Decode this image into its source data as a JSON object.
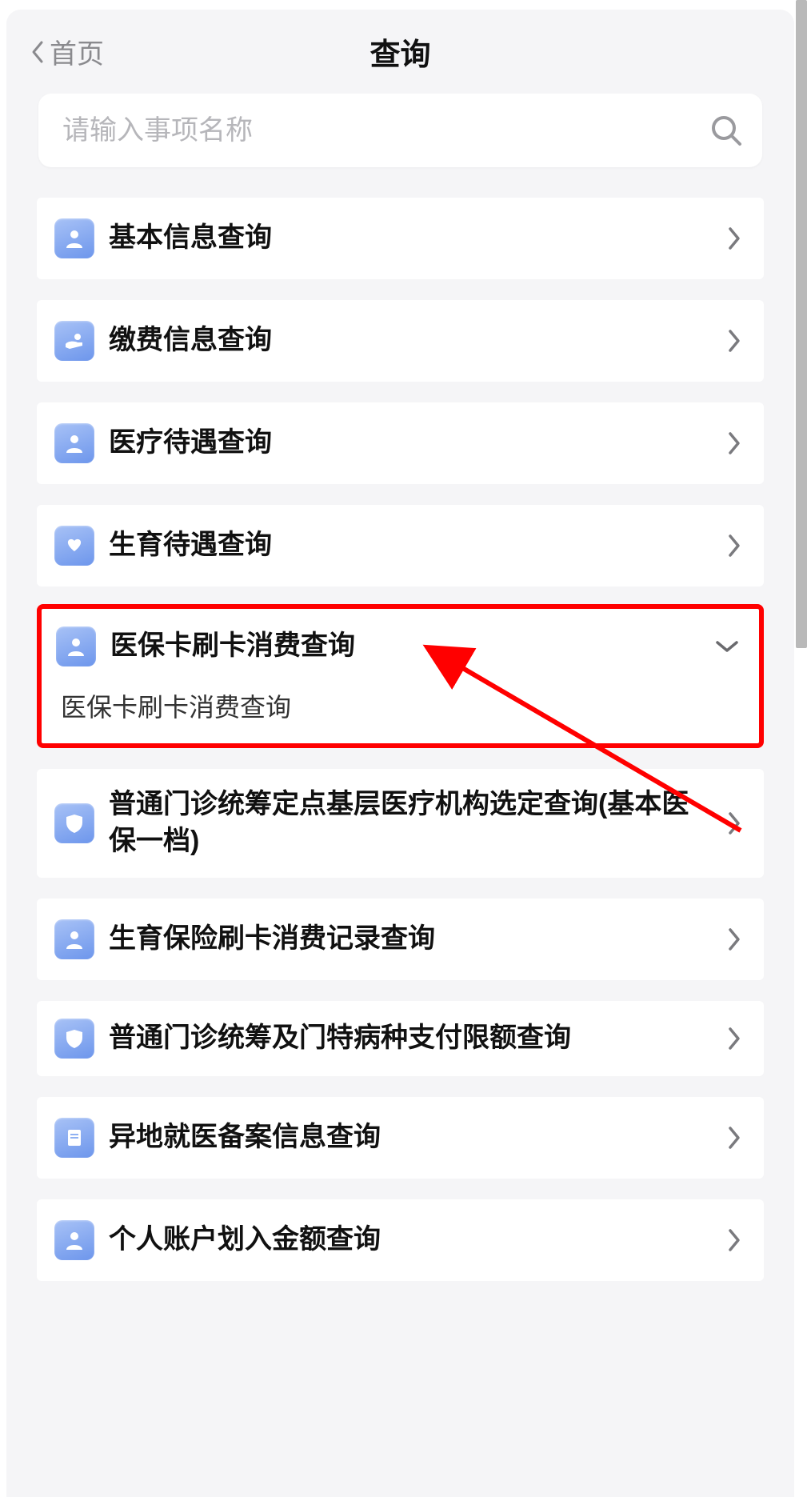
{
  "header": {
    "back_label": "首页",
    "title": "查询"
  },
  "search": {
    "placeholder": "请输入事项名称"
  },
  "items": [
    {
      "icon": "person",
      "label": "基本信息查询",
      "arrow": "right"
    },
    {
      "icon": "hand",
      "label": "缴费信息查询",
      "arrow": "right"
    },
    {
      "icon": "person",
      "label": "医疗待遇查询",
      "arrow": "right"
    },
    {
      "icon": "heart-hands",
      "label": "生育待遇查询",
      "arrow": "right"
    },
    {
      "icon": "person",
      "label": "医保卡刷卡消费查询",
      "arrow": "down",
      "highlighted": true,
      "sub": "医保卡刷卡消费查询"
    },
    {
      "icon": "shield",
      "label": "普通门诊统筹定点基层医疗机构选定查询(基本医保一档)",
      "arrow": "right",
      "twoline": true
    },
    {
      "icon": "person",
      "label": "生育保险刷卡消费记录查询",
      "arrow": "right"
    },
    {
      "icon": "shield",
      "label": "普通门诊统筹及门特病种支付限额查询",
      "arrow": "right",
      "twoline": true
    },
    {
      "icon": "doc",
      "label": "异地就医备案信息查询",
      "arrow": "right"
    },
    {
      "icon": "person",
      "label": "个人账户划入金额查询",
      "arrow": "right"
    }
  ]
}
